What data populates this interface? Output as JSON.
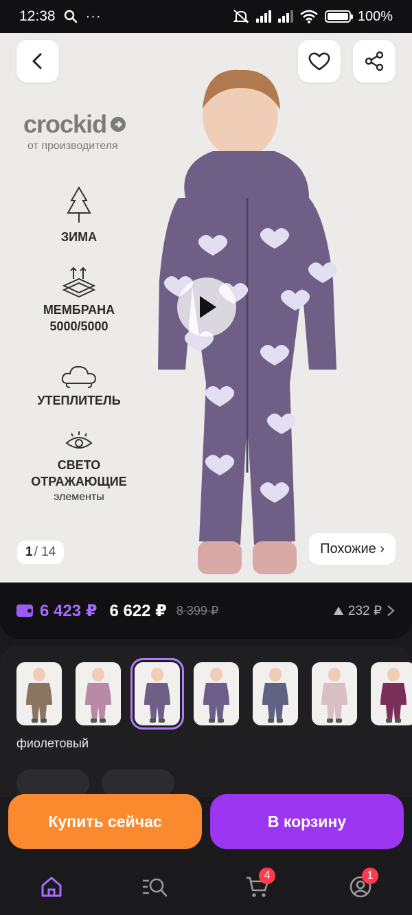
{
  "status_bar": {
    "time": "12:38",
    "battery": "100%"
  },
  "hero": {
    "brand_name": "crockid",
    "brand_sub": "от производителя",
    "features": [
      {
        "label": "ЗИМА"
      },
      {
        "label": "МЕМБРАНА 5000/5000"
      },
      {
        "label": "УТЕПЛИТЕЛЬ"
      },
      {
        "label": "СВЕТО ОТРАЖАЮЩИЕ",
        "sub": "элементы"
      }
    ],
    "image_index": "1",
    "image_total": "/ 14",
    "similar_label": "Похожие ›"
  },
  "price": {
    "wallet_price": "6 423 ₽",
    "price": "6 622 ₽",
    "old_price": "8 399 ₽",
    "diff": "232 ₽"
  },
  "variants": {
    "color_name": "фиолетовый",
    "thumbs": [
      {
        "color": "#8a7660",
        "selected": false
      },
      {
        "color": "#b88aa6",
        "selected": false
      },
      {
        "color": "#6e5f86",
        "selected": true
      },
      {
        "color": "#6b5f8a",
        "selected": false
      },
      {
        "color": "#5f6280",
        "selected": false
      },
      {
        "color": "#d9bfc4",
        "selected": false
      },
      {
        "color": "#7a2f5a",
        "selected": false
      }
    ]
  },
  "actions": {
    "buy_now": "Купить сейчас",
    "add_to_cart": "В корзину"
  },
  "nav": {
    "cart_badge": "4",
    "profile_badge": "1"
  },
  "colors": {
    "accent": "#9b35f0",
    "orange": "#fb8a2e",
    "wallet": "#a66cff",
    "badge": "#ff3b4e"
  }
}
